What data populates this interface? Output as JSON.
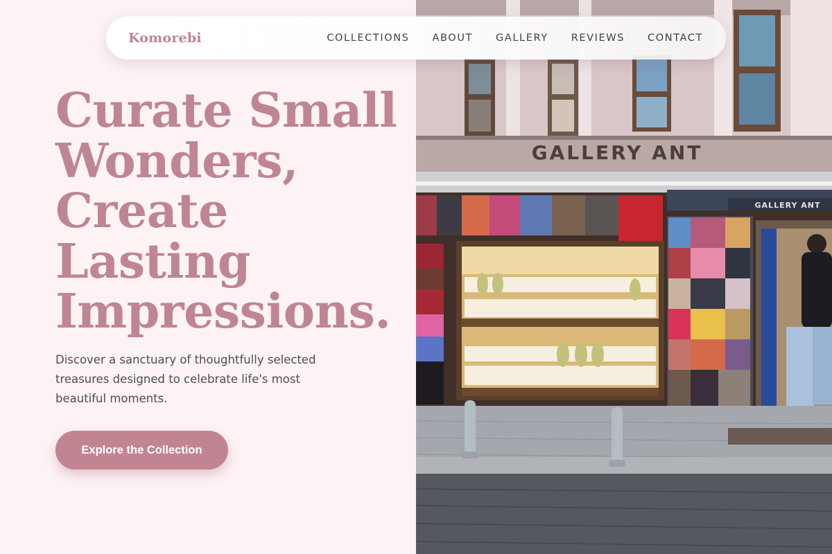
{
  "brand": {
    "name": "Komorebi"
  },
  "nav": {
    "items": [
      "COLLECTIONS",
      "ABOUT",
      "GALLERY",
      "REVIEWS",
      "CONTACT"
    ]
  },
  "hero": {
    "headline_lines": [
      "Curate Small",
      "Wonders,",
      "Create",
      "Lasting",
      "Impressions."
    ],
    "subtext": "Discover a sanctuary of thoughtfully selected treasures designed to celebrate life's most beautiful moments.",
    "cta_label": "Explore the Collection"
  },
  "photo": {
    "shop_sign": "GALLERY ANT",
    "small_sign": "GALLERY ANT"
  },
  "colors": {
    "accent": "#c08592",
    "page_bg": "#fdf3f4",
    "cta_bg": "#c38492",
    "body_text": "#4a4d55"
  }
}
